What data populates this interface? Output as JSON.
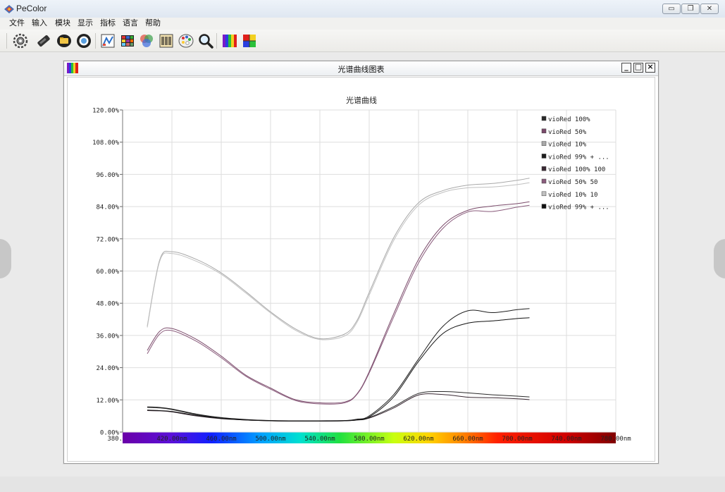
{
  "app": {
    "title": "PeColor"
  },
  "window_controls": {
    "minimize": "▭",
    "restore": "❐",
    "close": "✕"
  },
  "menu": [
    "文件",
    "输入",
    "模块",
    "显示",
    "指标",
    "语言",
    "帮助"
  ],
  "toolbar_icons": [
    "gear-icon",
    "measure-instrument-icon",
    "folder-open-icon",
    "target-ring-icon",
    "swatch-chart-icon",
    "color-grid-icon",
    "color-circles-icon",
    "barcode-sheet-icon",
    "palette-icon",
    "magnifier-icon",
    "spectrum-bars-icon",
    "color-quad-icon"
  ],
  "chart_window": {
    "title": "光谱曲线图表",
    "controls": {
      "minimize": "_",
      "maximize": "□",
      "close": "×"
    }
  },
  "colors": {
    "grid": "#dcdcdc",
    "series_dark": "#2a2a2a",
    "series_purple": "#7a4a6a",
    "series_light": "#a9a9a9"
  },
  "chart_data": {
    "type": "line",
    "title": "光谱曲线",
    "xlabel": "",
    "ylabel": "",
    "ylim": [
      0,
      120
    ],
    "xlim": [
      380,
      780
    ],
    "y_ticks": [
      "0.00%",
      "12.00%",
      "24.00%",
      "36.00%",
      "48.00%",
      "60.00%",
      "72.00%",
      "84.00%",
      "96.00%",
      "108.00%",
      "120.00%"
    ],
    "x_ticks": [
      "380.",
      "420.00nm",
      "460.00nm",
      "500.00nm",
      "540.00nm",
      "580.00nm",
      "620.00nm",
      "660.00nm",
      "700.00nm",
      "740.00nm",
      "780.00nm"
    ],
    "legend_position": "top-right",
    "grid": true,
    "x": [
      400,
      410,
      420,
      440,
      460,
      480,
      500,
      520,
      540,
      560,
      570,
      580,
      600,
      620,
      640,
      660,
      680,
      700,
      710
    ],
    "series": [
      {
        "name": "vioRed 100%",
        "color": "#2a2a2a",
        "values": [
          9.2,
          9.0,
          8.4,
          6.5,
          5.2,
          4.6,
          4.3,
          4.2,
          4.2,
          4.3,
          4.6,
          5.4,
          9.5,
          14.4,
          15.1,
          14.6,
          13.9,
          13.4,
          13.1
        ]
      },
      {
        "name": "vioRed 50%",
        "color": "#7a4a6a",
        "values": [
          30.4,
          37.5,
          38.6,
          34.5,
          28.3,
          21.2,
          16.4,
          12.1,
          10.9,
          11.2,
          14.2,
          22.5,
          44.2,
          64.3,
          77.1,
          82.6,
          84.2,
          85.1,
          85.8
        ]
      },
      {
        "name": "vioRed 10%",
        "color": "#a9a9a9",
        "values": [
          39.5,
          64.0,
          67.2,
          64.3,
          59.3,
          52.3,
          44.8,
          38.5,
          34.8,
          36.5,
          41.5,
          52.0,
          72.5,
          85.4,
          90.0,
          92.0,
          92.6,
          93.8,
          94.6
        ]
      },
      {
        "name": "vioRed 99% + ...",
        "color": "#1e1e1e",
        "values": [
          9.4,
          9.2,
          8.6,
          6.7,
          5.4,
          4.7,
          4.3,
          4.2,
          4.2,
          4.3,
          4.8,
          6.0,
          14.0,
          27.2,
          39.5,
          45.2,
          44.5,
          45.6,
          46.0
        ]
      },
      {
        "name": "vioRed 100% 100",
        "color": "#3a2a34",
        "values": [
          8.0,
          7.9,
          7.5,
          6.0,
          5.0,
          4.5,
          4.2,
          4.1,
          4.1,
          4.2,
          4.5,
          5.2,
          9.0,
          13.8,
          14.0,
          13.0,
          12.8,
          12.4,
          12.1
        ]
      },
      {
        "name": "vioRed 50% 50",
        "color": "#8a5c7c",
        "values": [
          29.2,
          36.5,
          37.8,
          33.8,
          27.7,
          20.8,
          16.0,
          11.8,
          10.5,
          10.9,
          14.0,
          22.0,
          43.0,
          63.0,
          76.0,
          82.0,
          82.2,
          83.8,
          84.5
        ]
      },
      {
        "name": "vioRed 10% 10",
        "color": "#c0c0c0",
        "values": [
          39.0,
          63.5,
          66.5,
          63.6,
          58.8,
          51.8,
          44.4,
          38.0,
          34.5,
          35.8,
          40.8,
          51.0,
          71.5,
          84.5,
          89.3,
          91.0,
          91.3,
          92.2,
          92.9
        ]
      },
      {
        "name": "vioRed 99% + ...",
        "color": "#111111",
        "values": [
          8.2,
          8.0,
          7.7,
          6.2,
          5.1,
          4.5,
          4.2,
          4.1,
          4.1,
          4.2,
          4.5,
          5.6,
          13.2,
          26.3,
          36.8,
          40.6,
          41.4,
          42.3,
          42.6
        ]
      }
    ]
  }
}
